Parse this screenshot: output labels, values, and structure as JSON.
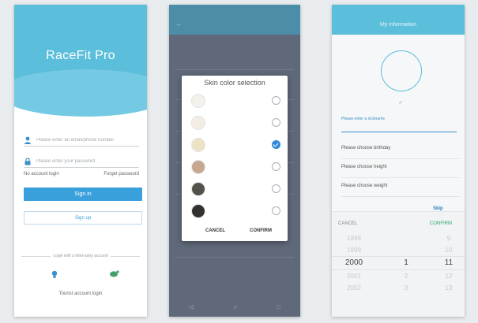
{
  "colors": {
    "primary": "#5bbedb",
    "button": "#3aa0dc",
    "check": "#2f88d8",
    "confirm_green": "#2aa36a"
  },
  "login": {
    "title": "RaceFit Pro",
    "account_placeholder": "Please enter an email/phone number",
    "password_placeholder": "Please enter your password",
    "remember_label": "No account login",
    "forgot_label": "Forget password",
    "login_button": "Sign in",
    "register_button": "Sign up",
    "third_party_label": "Login with a third-party account",
    "bottom_link": "Tourist account login",
    "icons": [
      "user-icon",
      "lock-icon",
      "wechat-icon",
      "weibo-icon"
    ]
  },
  "skin_dialog": {
    "title": "Skin color selection",
    "swatches": [
      {
        "color": "#f3f1ec",
        "checked": false
      },
      {
        "color": "#f2eee6",
        "checked": false
      },
      {
        "color": "#ece2c6",
        "checked": true
      },
      {
        "color": "#c6a792",
        "checked": false
      },
      {
        "color": "#54514d",
        "checked": false
      },
      {
        "color": "#333130",
        "checked": false
      }
    ],
    "cancel": "CANCEL",
    "confirm": "CONFIRM"
  },
  "user_info": {
    "header_title": "My information",
    "nickname_label": "Please enter a nickname",
    "rows": [
      "Please choose birthday",
      "Please choose height",
      "Please choose weight"
    ],
    "skip": "Skip",
    "picker": {
      "cancel": "CANCEL",
      "confirm": "CONFIRM",
      "years": [
        "1998",
        "1999",
        "2000",
        "2001",
        "2002"
      ],
      "months": [
        "",
        "",
        "1",
        "2",
        "3"
      ],
      "days": [
        "9",
        "10",
        "11",
        "12",
        "13"
      ]
    }
  }
}
